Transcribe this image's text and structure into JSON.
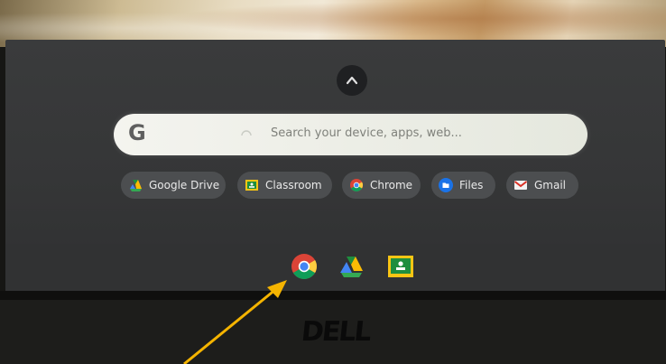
{
  "launcher": {
    "search": {
      "logo": "G",
      "placeholder": "Search your device, apps, web..."
    },
    "suggested_apps": [
      {
        "label": "Google Drive",
        "icon": "google-drive-icon"
      },
      {
        "label": "Classroom",
        "icon": "classroom-icon"
      },
      {
        "label": "Chrome",
        "icon": "chrome-icon"
      },
      {
        "label": "Files",
        "icon": "files-icon"
      },
      {
        "label": "Gmail",
        "icon": "gmail-icon"
      }
    ],
    "expand_icon": "chevron-up-icon"
  },
  "shelf": {
    "apps": [
      {
        "icon": "chrome-icon"
      },
      {
        "icon": "google-drive-icon"
      },
      {
        "icon": "classroom-icon"
      }
    ]
  },
  "bezel": {
    "brand": "DELL"
  },
  "colors": {
    "annotation_arrow": "#f5b400",
    "launcher_bg": "#363738",
    "chip_bg": "#4c4e50"
  }
}
